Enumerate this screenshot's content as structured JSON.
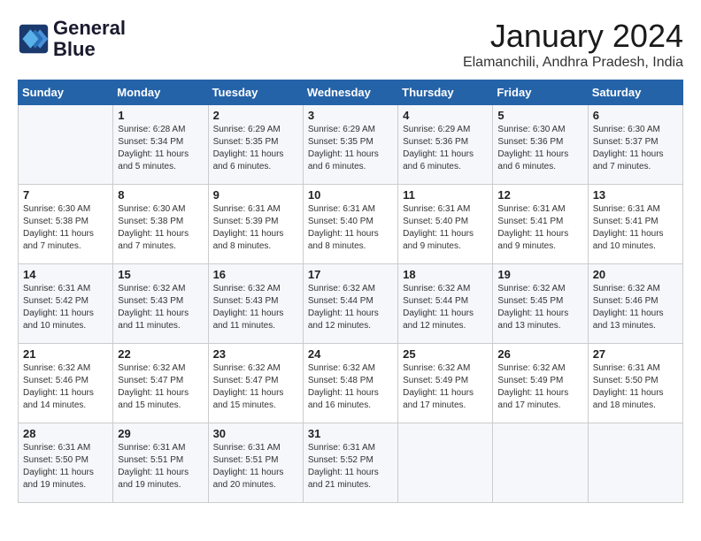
{
  "logo": {
    "line1": "General",
    "line2": "Blue"
  },
  "title": "January 2024",
  "location": "Elamanchili, Andhra Pradesh, India",
  "days_of_week": [
    "Sunday",
    "Monday",
    "Tuesday",
    "Wednesday",
    "Thursday",
    "Friday",
    "Saturday"
  ],
  "weeks": [
    [
      {
        "day": "",
        "info": ""
      },
      {
        "day": "1",
        "info": "Sunrise: 6:28 AM\nSunset: 5:34 PM\nDaylight: 11 hours\nand 5 minutes."
      },
      {
        "day": "2",
        "info": "Sunrise: 6:29 AM\nSunset: 5:35 PM\nDaylight: 11 hours\nand 6 minutes."
      },
      {
        "day": "3",
        "info": "Sunrise: 6:29 AM\nSunset: 5:35 PM\nDaylight: 11 hours\nand 6 minutes."
      },
      {
        "day": "4",
        "info": "Sunrise: 6:29 AM\nSunset: 5:36 PM\nDaylight: 11 hours\nand 6 minutes."
      },
      {
        "day": "5",
        "info": "Sunrise: 6:30 AM\nSunset: 5:36 PM\nDaylight: 11 hours\nand 6 minutes."
      },
      {
        "day": "6",
        "info": "Sunrise: 6:30 AM\nSunset: 5:37 PM\nDaylight: 11 hours\nand 7 minutes."
      }
    ],
    [
      {
        "day": "7",
        "info": "Sunrise: 6:30 AM\nSunset: 5:38 PM\nDaylight: 11 hours\nand 7 minutes."
      },
      {
        "day": "8",
        "info": "Sunrise: 6:30 AM\nSunset: 5:38 PM\nDaylight: 11 hours\nand 7 minutes."
      },
      {
        "day": "9",
        "info": "Sunrise: 6:31 AM\nSunset: 5:39 PM\nDaylight: 11 hours\nand 8 minutes."
      },
      {
        "day": "10",
        "info": "Sunrise: 6:31 AM\nSunset: 5:40 PM\nDaylight: 11 hours\nand 8 minutes."
      },
      {
        "day": "11",
        "info": "Sunrise: 6:31 AM\nSunset: 5:40 PM\nDaylight: 11 hours\nand 9 minutes."
      },
      {
        "day": "12",
        "info": "Sunrise: 6:31 AM\nSunset: 5:41 PM\nDaylight: 11 hours\nand 9 minutes."
      },
      {
        "day": "13",
        "info": "Sunrise: 6:31 AM\nSunset: 5:41 PM\nDaylight: 11 hours\nand 10 minutes."
      }
    ],
    [
      {
        "day": "14",
        "info": "Sunrise: 6:31 AM\nSunset: 5:42 PM\nDaylight: 11 hours\nand 10 minutes."
      },
      {
        "day": "15",
        "info": "Sunrise: 6:32 AM\nSunset: 5:43 PM\nDaylight: 11 hours\nand 11 minutes."
      },
      {
        "day": "16",
        "info": "Sunrise: 6:32 AM\nSunset: 5:43 PM\nDaylight: 11 hours\nand 11 minutes."
      },
      {
        "day": "17",
        "info": "Sunrise: 6:32 AM\nSunset: 5:44 PM\nDaylight: 11 hours\nand 12 minutes."
      },
      {
        "day": "18",
        "info": "Sunrise: 6:32 AM\nSunset: 5:44 PM\nDaylight: 11 hours\nand 12 minutes."
      },
      {
        "day": "19",
        "info": "Sunrise: 6:32 AM\nSunset: 5:45 PM\nDaylight: 11 hours\nand 13 minutes."
      },
      {
        "day": "20",
        "info": "Sunrise: 6:32 AM\nSunset: 5:46 PM\nDaylight: 11 hours\nand 13 minutes."
      }
    ],
    [
      {
        "day": "21",
        "info": "Sunrise: 6:32 AM\nSunset: 5:46 PM\nDaylight: 11 hours\nand 14 minutes."
      },
      {
        "day": "22",
        "info": "Sunrise: 6:32 AM\nSunset: 5:47 PM\nDaylight: 11 hours\nand 15 minutes."
      },
      {
        "day": "23",
        "info": "Sunrise: 6:32 AM\nSunset: 5:47 PM\nDaylight: 11 hours\nand 15 minutes."
      },
      {
        "day": "24",
        "info": "Sunrise: 6:32 AM\nSunset: 5:48 PM\nDaylight: 11 hours\nand 16 minutes."
      },
      {
        "day": "25",
        "info": "Sunrise: 6:32 AM\nSunset: 5:49 PM\nDaylight: 11 hours\nand 17 minutes."
      },
      {
        "day": "26",
        "info": "Sunrise: 6:32 AM\nSunset: 5:49 PM\nDaylight: 11 hours\nand 17 minutes."
      },
      {
        "day": "27",
        "info": "Sunrise: 6:31 AM\nSunset: 5:50 PM\nDaylight: 11 hours\nand 18 minutes."
      }
    ],
    [
      {
        "day": "28",
        "info": "Sunrise: 6:31 AM\nSunset: 5:50 PM\nDaylight: 11 hours\nand 19 minutes."
      },
      {
        "day": "29",
        "info": "Sunrise: 6:31 AM\nSunset: 5:51 PM\nDaylight: 11 hours\nand 19 minutes."
      },
      {
        "day": "30",
        "info": "Sunrise: 6:31 AM\nSunset: 5:51 PM\nDaylight: 11 hours\nand 20 minutes."
      },
      {
        "day": "31",
        "info": "Sunrise: 6:31 AM\nSunset: 5:52 PM\nDaylight: 11 hours\nand 21 minutes."
      },
      {
        "day": "",
        "info": ""
      },
      {
        "day": "",
        "info": ""
      },
      {
        "day": "",
        "info": ""
      }
    ]
  ]
}
